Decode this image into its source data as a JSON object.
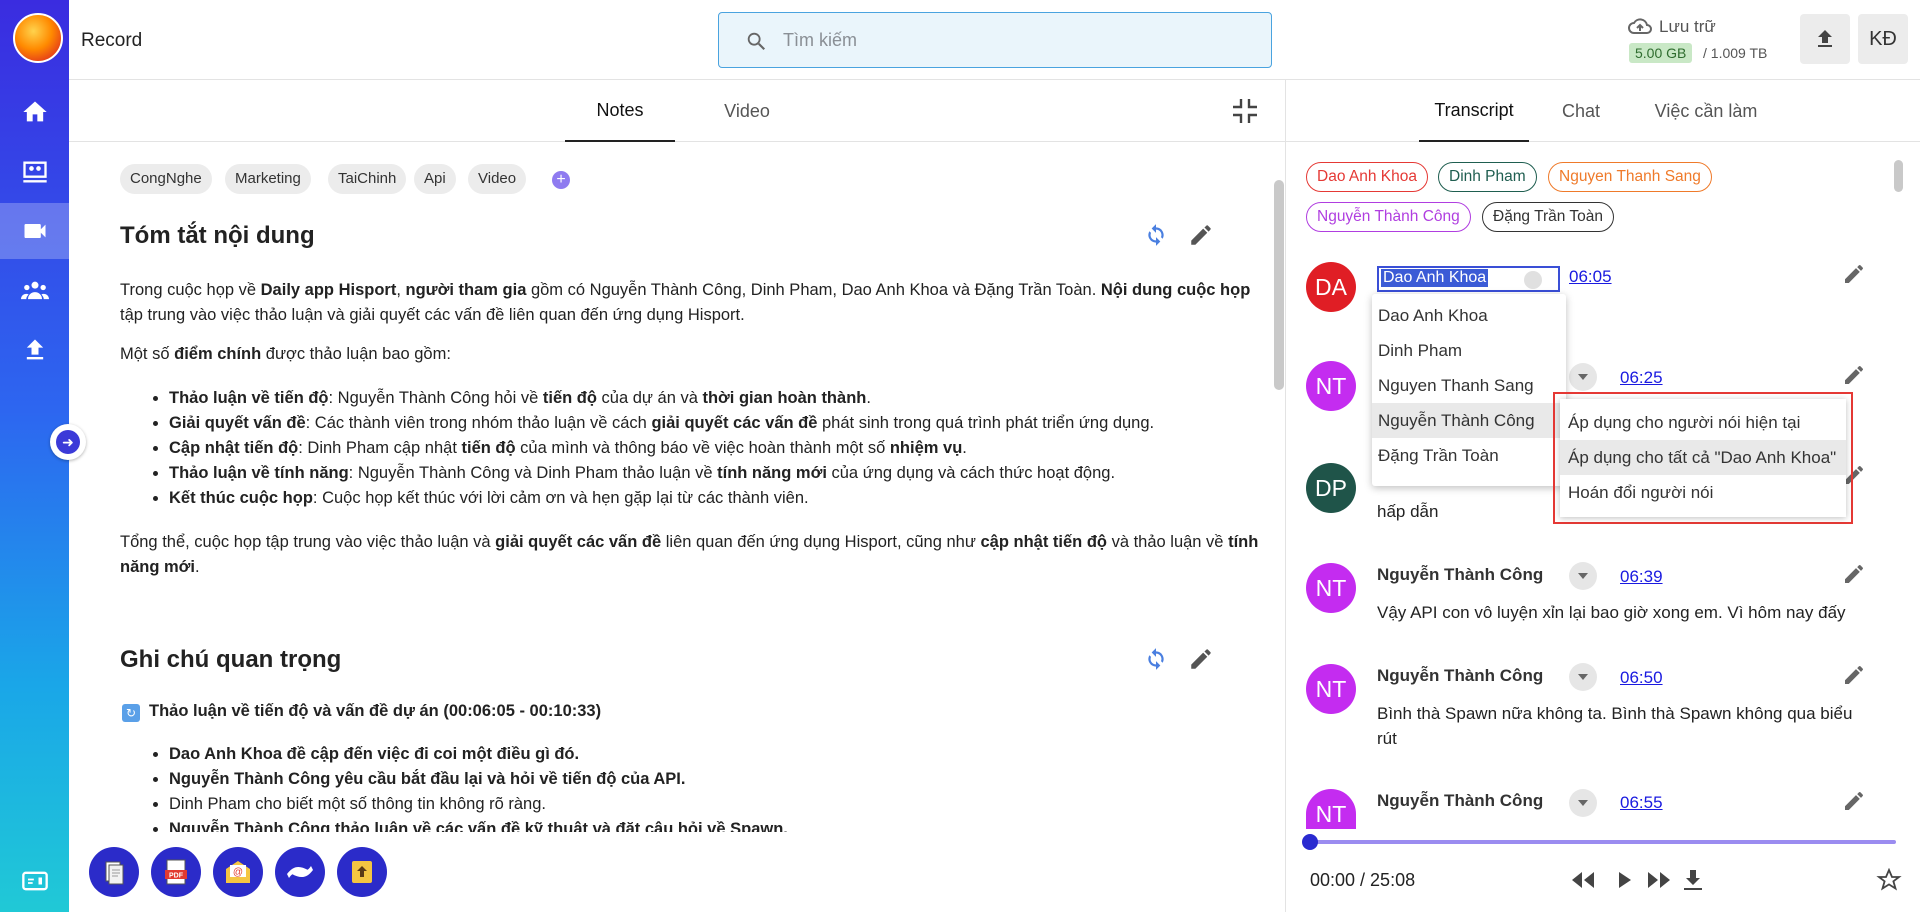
{
  "app": {
    "title": "Record"
  },
  "search": {
    "placeholder": "Tìm kiếm"
  },
  "storage": {
    "label": "Lưu trữ",
    "used": "5.00 GB",
    "total": "/ 1.009 TB"
  },
  "user": {
    "initials": "KĐ"
  },
  "left_tabs": [
    "Notes",
    "Video"
  ],
  "tags": [
    "CongNghe",
    "Marketing",
    "TaiChinh",
    "Api",
    "Video"
  ],
  "summary": {
    "title": "Tóm tắt nội dung",
    "intro": [
      {
        "t": "Trong cuộc họp về ",
        "b": false
      },
      {
        "t": "Daily app Hisport",
        "b": true
      },
      {
        "t": ", ",
        "b": false
      },
      {
        "t": "người tham gia",
        "b": true
      },
      {
        "t": " gồm có Nguyễn Thành Công, Dinh Pham, Dao Anh Khoa và Đặng Trần Toàn. ",
        "b": false
      },
      {
        "t": "Nội dung cuộc họp",
        "b": true
      },
      {
        "t": " tập trung vào việc thảo luận và giải quyết các vấn đề liên quan đến ứng dụng Hisport.",
        "b": false
      }
    ],
    "points_intro": [
      {
        "t": "Một số ",
        "b": false
      },
      {
        "t": "điểm chính",
        "b": true
      },
      {
        "t": " được thảo luận bao gồm:",
        "b": false
      }
    ],
    "points": [
      [
        {
          "t": "Thảo luận về tiến độ",
          "b": true
        },
        {
          "t": ": Nguyễn Thành Công hỏi về ",
          "b": false
        },
        {
          "t": "tiến độ",
          "b": true
        },
        {
          "t": " của dự án và ",
          "b": false
        },
        {
          "t": "thời gian hoàn thành",
          "b": true
        },
        {
          "t": ".",
          "b": false
        }
      ],
      [
        {
          "t": "Giải quyết vấn đề",
          "b": true
        },
        {
          "t": ": Các thành viên trong nhóm thảo luận về cách ",
          "b": false
        },
        {
          "t": "giải quyết các vấn đề",
          "b": true
        },
        {
          "t": " phát sinh trong quá trình phát triển ứng dụng.",
          "b": false
        }
      ],
      [
        {
          "t": "Cập nhật tiến độ",
          "b": true
        },
        {
          "t": ": Dinh Pham cập nhật ",
          "b": false
        },
        {
          "t": "tiến độ",
          "b": true
        },
        {
          "t": " của mình và thông báo về việc hoàn thành một số ",
          "b": false
        },
        {
          "t": "nhiệm vụ",
          "b": true
        },
        {
          "t": ".",
          "b": false
        }
      ],
      [
        {
          "t": "Thảo luận về tính năng",
          "b": true
        },
        {
          "t": ": Nguyễn Thành Công và Dinh Pham thảo luận về ",
          "b": false
        },
        {
          "t": "tính năng mới",
          "b": true
        },
        {
          "t": " của ứng dụng và cách thức hoạt động.",
          "b": false
        }
      ],
      [
        {
          "t": "Kết thúc cuộc họp",
          "b": true
        },
        {
          "t": ": Cuộc họp kết thúc với lời cảm ơn và hẹn gặp lại từ các thành viên.",
          "b": false
        }
      ]
    ],
    "conclusion": [
      {
        "t": "Tổng thể, cuộc họp tập trung vào việc thảo luận và ",
        "b": false
      },
      {
        "t": "giải quyết các vấn đề",
        "b": true
      },
      {
        "t": " liên quan đến ứng dụng Hisport, cũng như ",
        "b": false
      },
      {
        "t": "cập nhật tiến độ",
        "b": true
      },
      {
        "t": " và thảo luận về ",
        "b": false
      },
      {
        "t": "tính năng mới",
        "b": true
      },
      {
        "t": ".",
        "b": false
      }
    ]
  },
  "notes": {
    "title": "Ghi chú quan trọng",
    "topic": "Thảo luận về tiến độ và vấn đề dự án (00:06:05 - 00:10:33)",
    "items": [
      {
        "t": "Dao Anh Khoa đề cập đến việc đi coi một điều gì đó.",
        "b": true
      },
      {
        "t": "Nguyễn Thành Công yêu cầu bắt đầu lại và hỏi về tiến độ của API.",
        "b": true
      },
      {
        "t": "Dinh Pham cho biết một số thông tin không rõ ràng.",
        "b": false
      },
      {
        "t": "Nguyễn Thành Công thảo luận về các vấn đề kỹ thuật và đặt câu hỏi về Spawn.",
        "b": true
      }
    ]
  },
  "right_tabs": [
    "Transcript",
    "Chat",
    "Việc cần làm"
  ],
  "participants": [
    {
      "name": "Dao Anh Khoa",
      "color": "#e53935"
    },
    {
      "name": "Dinh Pham",
      "color": "#1f5e50"
    },
    {
      "name": "Nguyen Thanh Sang",
      "color": "#ef7a2a"
    },
    {
      "name": "Nguyễn Thành Công",
      "color": "#b03ee0"
    },
    {
      "name": "Đặng Trần Toàn",
      "color": "#333333"
    }
  ],
  "transcript": [
    {
      "initials": "DA",
      "color": "#e01e25",
      "speaker": "Dao Anh Khoa",
      "time": "06:05",
      "text": ""
    },
    {
      "initials": "NT",
      "color": "#c42cf0",
      "speaker": "",
      "time": "06:25",
      "text": ""
    },
    {
      "initials": "DP",
      "color": "#1f5449",
      "speaker": "",
      "time": "",
      "text": "hấp dẫn"
    },
    {
      "initials": "NT",
      "color": "#c42cf0",
      "speaker": "Nguyễn Thành Công",
      "time": "06:39",
      "text": "Vậy API con vô luyện xỉn lại bao giờ xong em. Vì hôm nay đấy"
    },
    {
      "initials": "NT",
      "color": "#c42cf0",
      "speaker": "Nguyễn Thành Công",
      "time": "06:50",
      "text": "Bình thà Spawn nữa không ta. Bình thà Spawn không qua biểu rút"
    },
    {
      "initials": "NT",
      "color": "#c42cf0",
      "speaker": "Nguyễn Thành Công",
      "time": "06:55",
      "text": ""
    }
  ],
  "speaker_select": {
    "value": "Dao Anh Khoa",
    "options": [
      "Dao Anh Khoa",
      "Dinh Pham",
      "Nguyen Thanh Sang",
      "Nguyễn Thành Công",
      "Đặng Trần Toàn"
    ],
    "highlighted": "Nguyễn Thành Công"
  },
  "apply_menu": [
    "Áp dụng cho người nói hiện tại",
    "Áp dụng cho tất cả \"Dao Anh Khoa\"",
    "Hoán đổi người nói"
  ],
  "player": {
    "time": "00:00 / 25:08",
    "progress": 0.0
  },
  "colors": {
    "accent": "#2a2ad0",
    "rail_top": "#3a2ce0",
    "rail_bottom": "#20c9d6",
    "highlight_frame": "#e53935"
  }
}
